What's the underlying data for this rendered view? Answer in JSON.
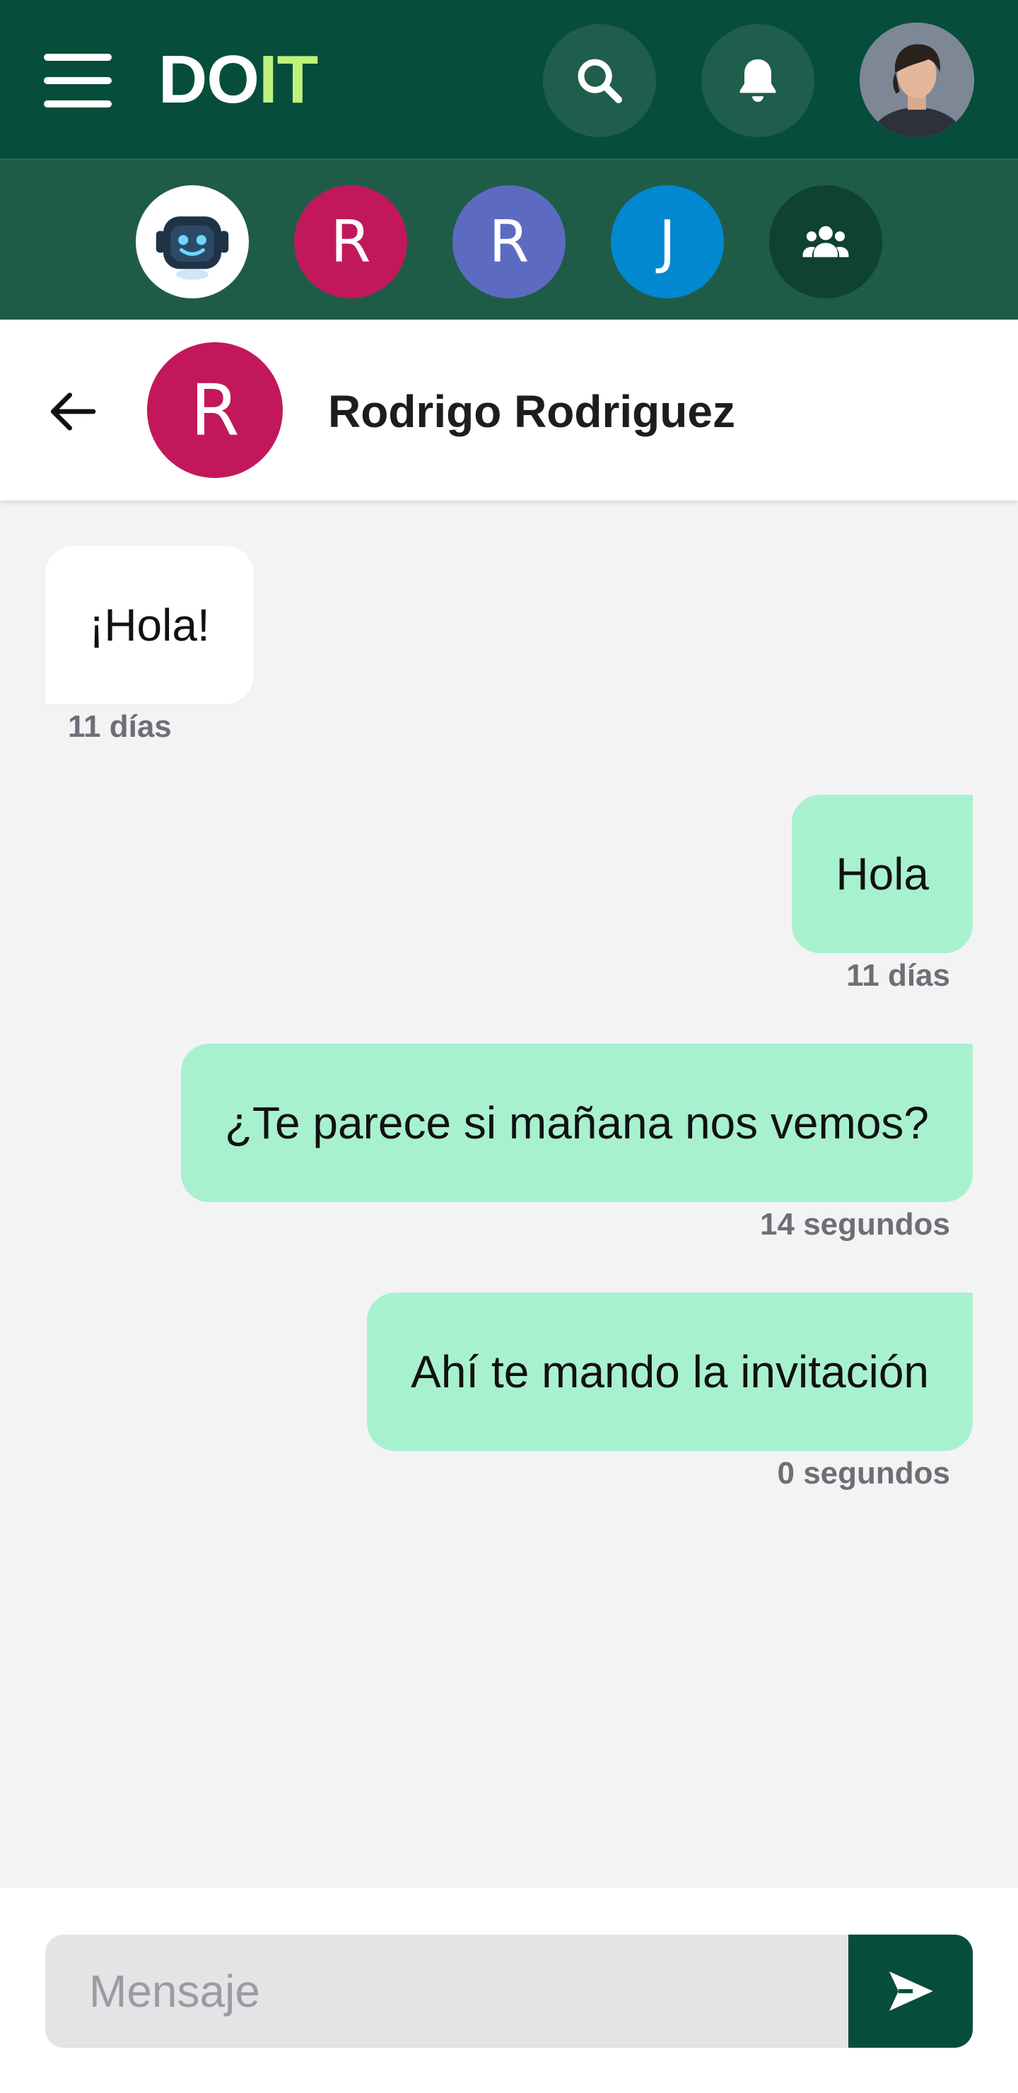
{
  "app": {
    "logo_part1": "DO",
    "logo_part2": "IT",
    "colors": {
      "primary": "#074d3b",
      "accent": "#bff27c",
      "outgoing_bubble": "#a8f1cf"
    }
  },
  "header": {
    "icons": [
      "menu-icon",
      "search-icon",
      "bell-icon",
      "user-avatar"
    ]
  },
  "contacts_strip": {
    "items": [
      {
        "type": "bot",
        "icon": "robot-icon",
        "bg": "#ffffff"
      },
      {
        "type": "initial",
        "initial": "R",
        "bg": "#c2185b"
      },
      {
        "type": "initial",
        "initial": "R",
        "bg": "#5c6bc0"
      },
      {
        "type": "initial",
        "initial": "J",
        "bg": "#0288d1"
      },
      {
        "type": "group",
        "icon": "group-icon",
        "bg": "#0f4233"
      }
    ]
  },
  "chat": {
    "contact_initial": "R",
    "contact_name": "Rodrigo Rodriguez",
    "messages": [
      {
        "direction": "in",
        "text": "¡Hola!",
        "time": "11 días"
      },
      {
        "direction": "out",
        "text": "Hola",
        "time": "11 días"
      },
      {
        "direction": "out",
        "text": "¿Te parece si mañana nos vemos?",
        "time": "14 segundos"
      },
      {
        "direction": "out",
        "text": "Ahí te mando la invitación",
        "time": "0 segundos"
      }
    ]
  },
  "composer": {
    "placeholder": "Mensaje",
    "value": ""
  }
}
